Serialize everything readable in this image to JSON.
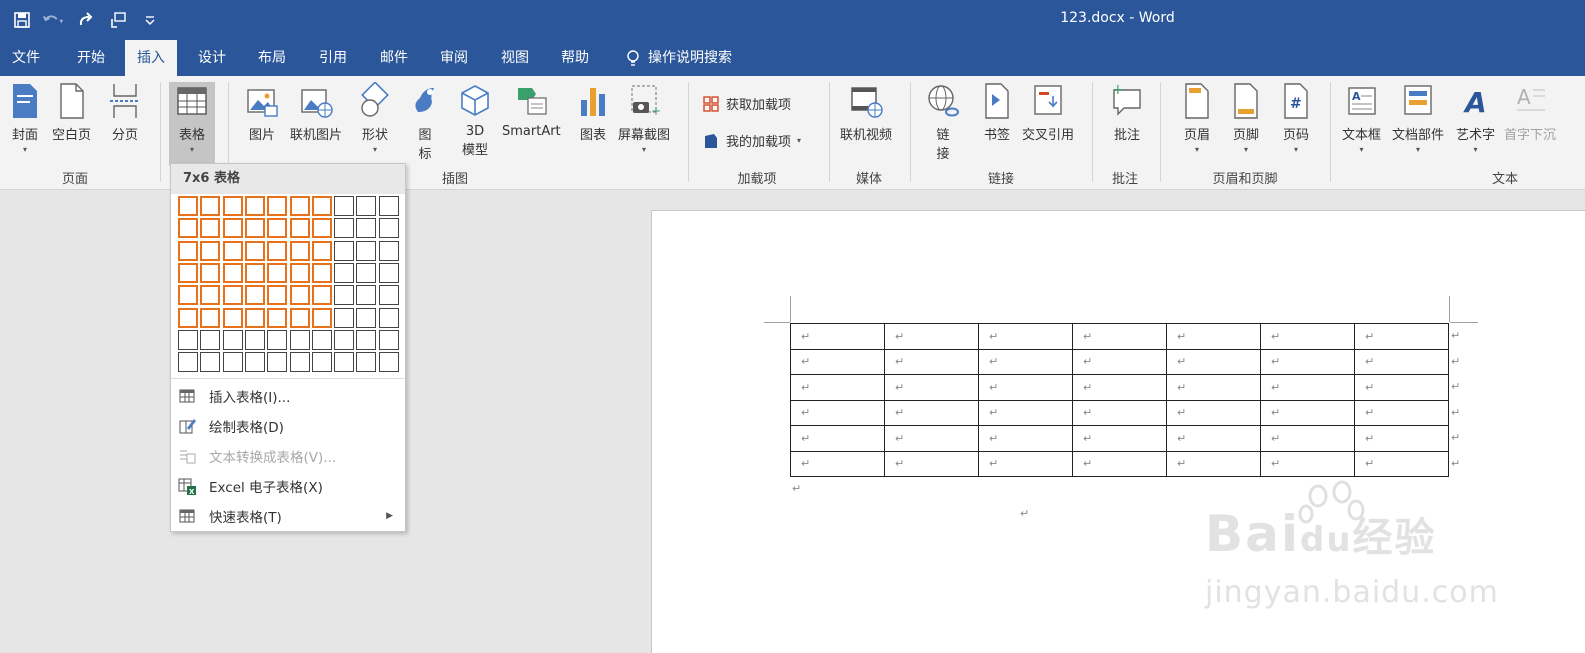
{
  "window": {
    "title": "123.docx  -  Word"
  },
  "qat": {
    "icons": [
      "save-icon",
      "undo-icon",
      "redo-icon",
      "touch-mode-icon",
      "customize-qat-icon"
    ]
  },
  "tabs": [
    {
      "label": "文件"
    },
    {
      "label": "开始"
    },
    {
      "label": "插入"
    },
    {
      "label": "设计"
    },
    {
      "label": "布局"
    },
    {
      "label": "引用"
    },
    {
      "label": "邮件"
    },
    {
      "label": "审阅"
    },
    {
      "label": "视图"
    },
    {
      "label": "帮助"
    }
  ],
  "tell_me": "操作说明搜索",
  "ribbon": {
    "pages": {
      "cover": "封面",
      "blank": "空白页",
      "break": "分页",
      "group": "页面"
    },
    "tables": {
      "table": "表格"
    },
    "illustrations": {
      "picture": "图片",
      "online_picture": "联机图片",
      "shapes": "形状",
      "icons_l1": "图",
      "icons_l2": "标",
      "model_l1": "3D",
      "model_l2": "模型",
      "smartart": "SmartArt",
      "chart": "图表",
      "screenshot": "屏幕截图",
      "group": "插图"
    },
    "addins": {
      "get": "获取加载项",
      "mine": "我的加载项",
      "group": "加载项"
    },
    "media": {
      "video": "联机视频",
      "group": "媒体"
    },
    "links": {
      "link_l1": "链",
      "link_l2": "接",
      "bookmark": "书签",
      "crossref": "交叉引用",
      "group": "链接"
    },
    "comments": {
      "comment": "批注",
      "group": "批注"
    },
    "header_footer": {
      "header": "页眉",
      "footer": "页脚",
      "page_number": "页码",
      "group": "页眉和页脚"
    },
    "text": {
      "textbox": "文本框",
      "quickparts": "文档部件",
      "wordart": "艺术字",
      "dropcap": "首字下沉",
      "group": "文本"
    }
  },
  "dropdown": {
    "header": "7x6 表格",
    "grid": {
      "cols": 10,
      "rows": 8,
      "sel_cols": 7,
      "sel_rows": 6
    },
    "items": [
      {
        "label": "插入表格(I)...",
        "disabled": false
      },
      {
        "label": "绘制表格(D)",
        "disabled": false
      },
      {
        "label": "文本转换成表格(V)...",
        "disabled": true
      },
      {
        "label": "Excel 电子表格(X)",
        "disabled": false
      },
      {
        "label": "快速表格(T)",
        "disabled": false
      }
    ]
  },
  "document": {
    "table": {
      "rows": 6,
      "cols": 7,
      "cell_mark": "↵"
    },
    "para_mark": "↵"
  },
  "watermark": {
    "brand": "Bai",
    "brand_mid": "du",
    "brand_cn": "经验",
    "url": "jingyan.baidu.com"
  }
}
